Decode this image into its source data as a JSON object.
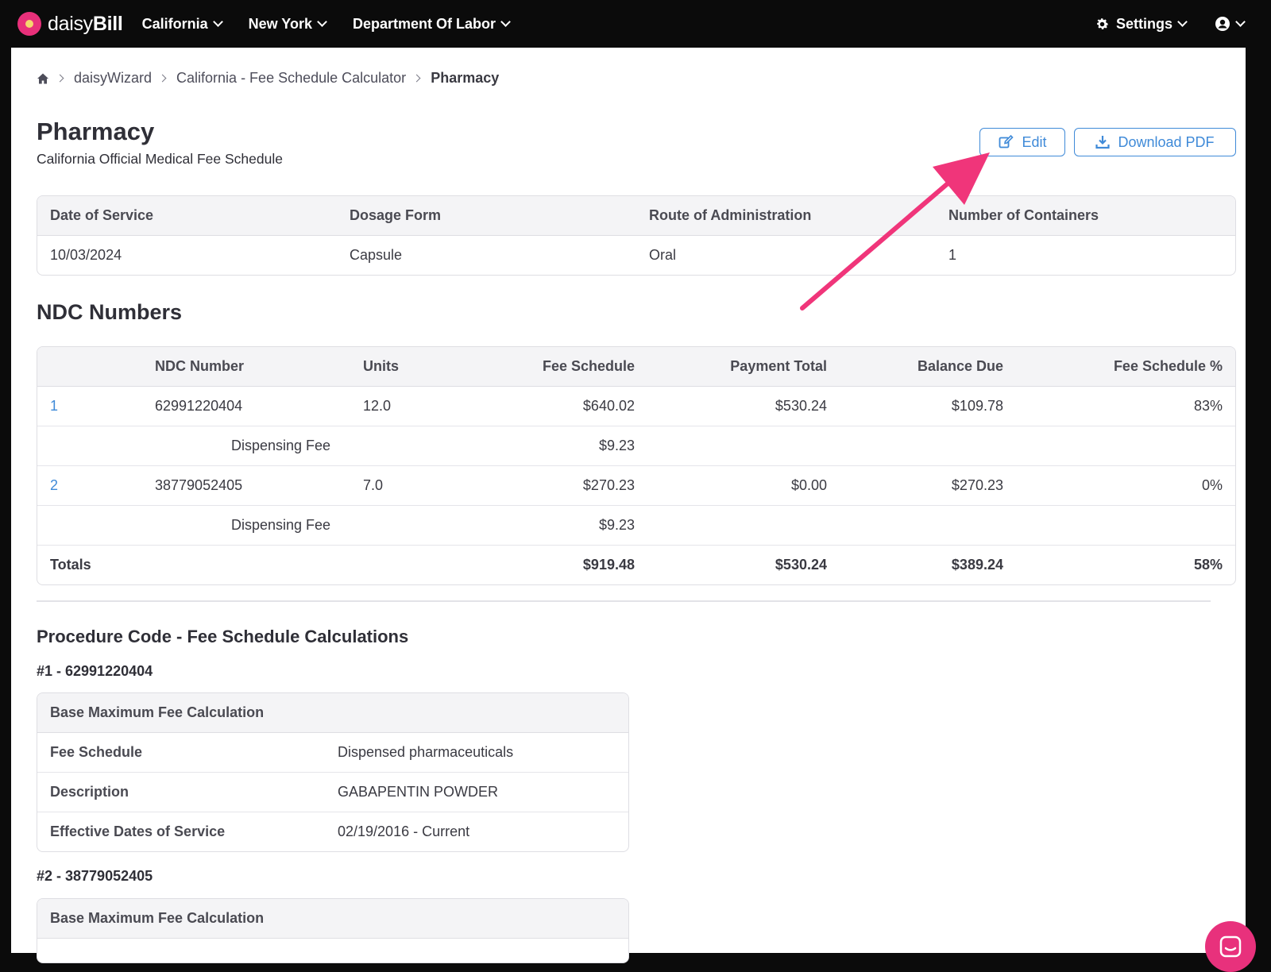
{
  "app": {
    "logo_text_light": "daisy",
    "logo_text_bold": "Bill",
    "nav": [
      "California",
      "New York",
      "Department Of Labor"
    ],
    "settings_label": "Settings"
  },
  "breadcrumb": {
    "items": [
      "daisyWizard",
      "California - Fee Schedule Calculator"
    ],
    "current": "Pharmacy"
  },
  "page": {
    "title": "Pharmacy",
    "subtitle": "California Official Medical Fee Schedule",
    "edit_label": "Edit",
    "download_label": "Download PDF"
  },
  "summary": {
    "headers": [
      "Date of Service",
      "Dosage Form",
      "Route of Administration",
      "Number of Containers"
    ],
    "values": [
      "10/03/2024",
      "Capsule",
      "Oral",
      "1"
    ]
  },
  "ndc": {
    "heading": "NDC Numbers",
    "headers": [
      "",
      "NDC Number",
      "Units",
      "Fee Schedule",
      "Payment Total",
      "Balance Due",
      "Fee Schedule %"
    ],
    "rows": [
      {
        "index": "1",
        "ndc": "62991220404",
        "units": "12.0",
        "fee": "$640.02",
        "payment": "$530.24",
        "balance": "$109.78",
        "pct": "83%"
      },
      {
        "dispensing_label": "Dispensing Fee",
        "dispensing_fee": "$9.23"
      },
      {
        "index": "2",
        "ndc": "38779052405",
        "units": "7.0",
        "fee": "$270.23",
        "payment": "$0.00",
        "balance": "$270.23",
        "pct": "0%"
      },
      {
        "dispensing_label": "Dispensing Fee",
        "dispensing_fee": "$9.23"
      }
    ],
    "totals": {
      "label": "Totals",
      "fee": "$919.48",
      "payment": "$530.24",
      "balance": "$389.24",
      "pct": "58%"
    }
  },
  "procedure": {
    "heading": "Procedure Code - Fee Schedule Calculations",
    "items": [
      {
        "label": "#1 - 62991220404",
        "table_header": "Base Maximum Fee Calculation",
        "rows": [
          {
            "key": "Fee Schedule",
            "value": "Dispensed pharmaceuticals"
          },
          {
            "key": "Description",
            "value": "GABAPENTIN POWDER"
          },
          {
            "key": "Effective Dates of Service",
            "value": "02/19/2016 - Current"
          }
        ]
      },
      {
        "label": "#2 - 38779052405",
        "table_header": "Base Maximum Fee Calculation"
      }
    ]
  },
  "colors": {
    "accent": "#3f8ad8",
    "annotation_arrow": "#f0357a",
    "chat": "#e8317c"
  }
}
